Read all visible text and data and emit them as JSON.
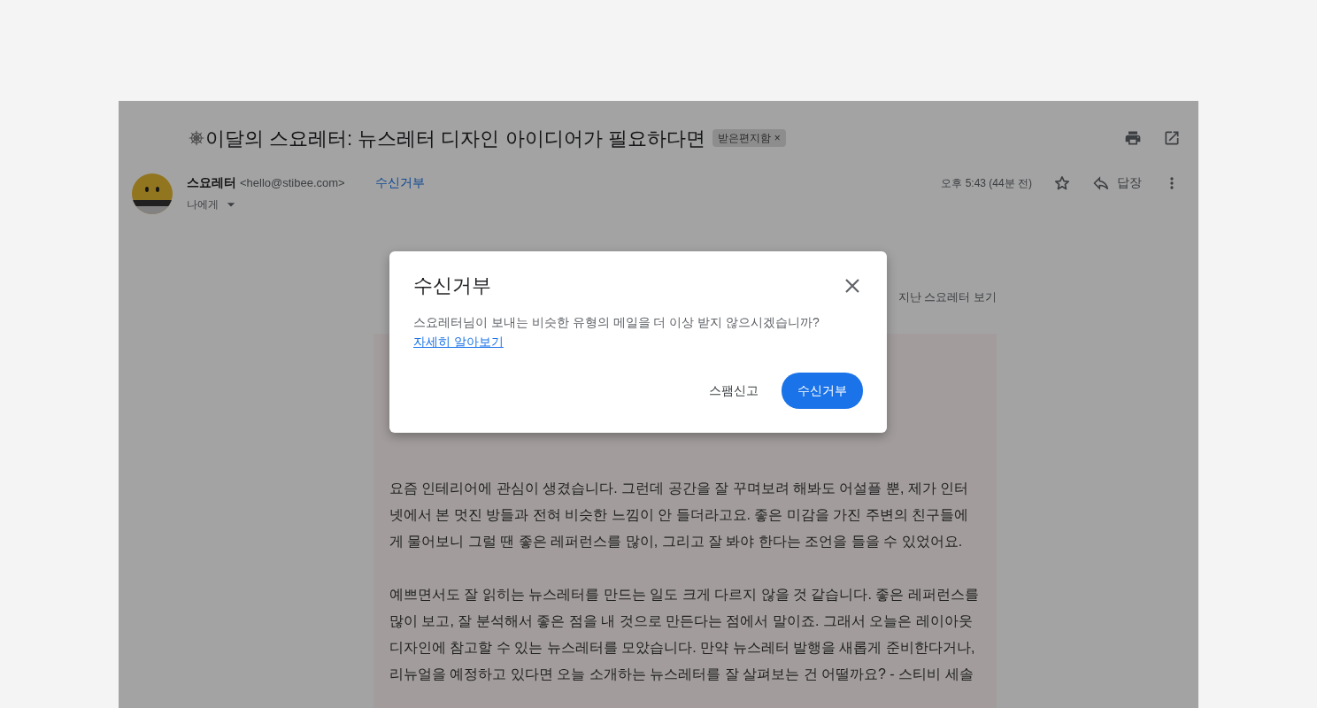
{
  "email": {
    "subject": "이달의 스요레터: 뉴스레터 디자인 아이디어가 필요하다면",
    "labels": [
      {
        "text": "받은편지함",
        "remove": "×"
      }
    ],
    "sender": {
      "name": "스요레터",
      "address": "<hello@stibee.com>",
      "recipient": "나에게"
    },
    "unsubscribe_link": "수신거부",
    "time": "오후 5:43 (44분 전)",
    "starred": false,
    "reply": "답장"
  },
  "newsletter": {
    "archive_link": "지난 스요레터 보기",
    "paragraphs": [
      "요즘 인테리어에 관심이 생겼습니다. 그런데 공간을 잘 꾸며보려 해봐도 어설플 뿐, 제가 인터넷에서 본 멋진 방들과 전혀 비슷한 느낌이 안 들더라고요. 좋은 미감을 가진 주변의 친구들에게 물어보니 그럴 땐 좋은 레퍼런스를 많이, 그리고 잘 봐야 한다는 조언을 들을 수 있었어요.",
      "예쁘면서도 잘 읽히는 뉴스레터를 만드는 일도 크게 다르지 않을 것 같습니다. 좋은 레퍼런스를 많이 보고, 잘 분석해서 좋은 점을 내 것으로 만든다는 점에서 말이죠. 그래서 오늘은 레이아웃 디자인에 참고할 수 있는 뉴스레터를 모았습니다. 만약 뉴스레터 발행을 새롭게 준비한다거나, 리뉴얼을 예정하고 있다면 오늘 소개하는 뉴스레터를 잘 살펴보는 건 어떨까요? - 스티비 세솔"
    ]
  },
  "dialog": {
    "title": "수신거부",
    "message": "스요레터님이 보내는 비슷한 유형의 메일을 더 이상 받지 않으시겠습니까?",
    "link": "자세히 알아보기",
    "buttons": [
      {
        "label": "스팸신고",
        "kind": "text"
      },
      {
        "label": "수신거부",
        "kind": "primary"
      }
    ]
  }
}
